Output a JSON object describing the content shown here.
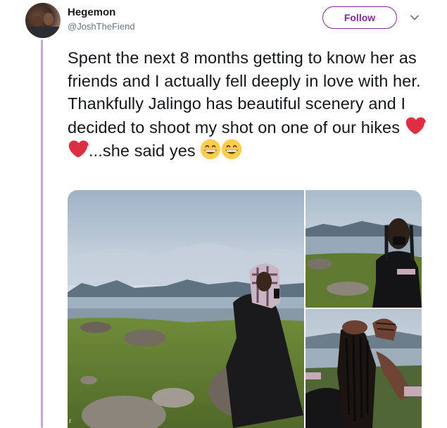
{
  "tweet": {
    "display_name": "Hegemon",
    "handle": "@JoshTheFiend",
    "follow_label": "Follow",
    "text_main": "Spent the next 8 months getting to know her as friends and I actually fell deeply in love with her. Thankfully Jalingo has beautiful scenery and I decided to shoot my shot on one of our hikes ",
    "text_after_hearts": "...she said yes ",
    "emojis": [
      "red-heart",
      "red-heart",
      "grinning-face",
      "grinning-face"
    ]
  },
  "media": {
    "count": 3,
    "watermark": "t"
  },
  "colors": {
    "accent": "#7b2f8f",
    "thread_line": "#c9a7d6",
    "text": "#14171a",
    "secondary_text": "#657786",
    "heart": "#e0245e",
    "emoji_face": "#ffcc4d"
  }
}
